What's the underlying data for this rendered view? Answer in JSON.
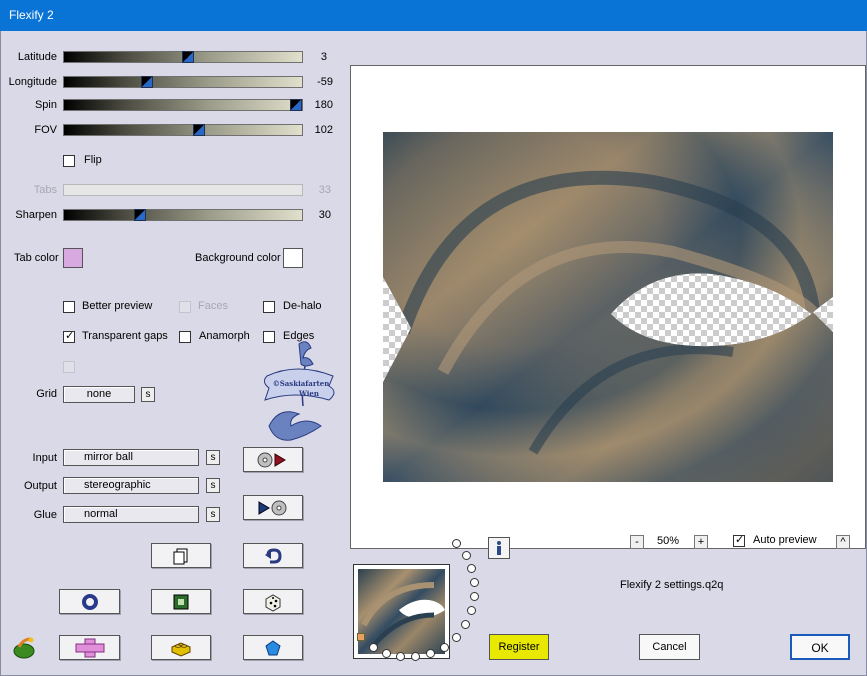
{
  "window": {
    "title": "Flexify 2"
  },
  "sliders": [
    {
      "label": "Latitude",
      "value": "3",
      "fraction": 0.52
    },
    {
      "label": "Longitude",
      "value": "-59",
      "fraction": 0.34
    },
    {
      "label": "Spin",
      "value": "180",
      "fraction": 1.0
    },
    {
      "label": "FOV",
      "value": "102",
      "fraction": 0.57
    }
  ],
  "flip": {
    "label": "Flip",
    "checked": false
  },
  "tabs": {
    "label": "Tabs",
    "value": "33",
    "enabled": false
  },
  "sharpen": {
    "label": "Sharpen",
    "value": "30",
    "fraction": 0.31
  },
  "tab_color": {
    "label": "Tab color",
    "color": "#d8a8e0"
  },
  "background_color": {
    "label": "Background color",
    "color": "#ffffff"
  },
  "options": {
    "better_preview": {
      "label": "Better preview",
      "checked": false
    },
    "faces": {
      "label": "Faces",
      "checked": false,
      "enabled": false
    },
    "de_halo": {
      "label": "De-halo",
      "checked": false
    },
    "transparent_gaps": {
      "label": "Transparent gaps",
      "checked": true
    },
    "anamorph": {
      "label": "Anamorph",
      "checked": false
    },
    "edges": {
      "label": "Edges",
      "checked": false
    }
  },
  "grid": {
    "label": "Grid",
    "value": "none",
    "s_label": "s"
  },
  "input": {
    "label": "Input",
    "value": "mirror ball",
    "s_label": "s"
  },
  "output": {
    "label": "Output",
    "value": "stereographic",
    "s_label": "s"
  },
  "glue": {
    "label": "Glue",
    "value": "normal",
    "s_label": "s"
  },
  "watermark": {
    "line1": "©Saskiafarten",
    "line2": "Wien"
  },
  "zoom": {
    "minus": "-",
    "value": "50%",
    "plus": "+"
  },
  "auto_preview": {
    "label": "Auto preview",
    "checked": true,
    "arrow": "^"
  },
  "settings_file": "Flexify 2 settings.q2q",
  "buttons": {
    "register": "Register",
    "cancel": "Cancel",
    "ok": "OK"
  },
  "icons": {
    "info": "info-icon",
    "register_color": "#e8e800"
  }
}
